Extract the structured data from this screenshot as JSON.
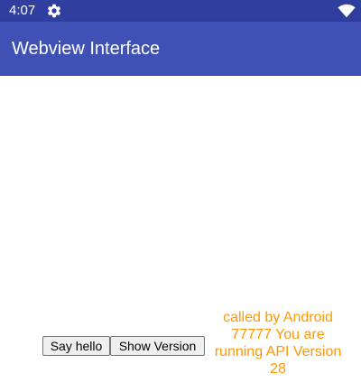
{
  "status_bar": {
    "time": "4:07",
    "icons": [
      "gear-icon",
      "wifi-icon"
    ],
    "color": "#303f9f"
  },
  "app_bar": {
    "title": "Webview Interface",
    "color": "#3f51b5"
  },
  "webview": {
    "buttons": {
      "say_hello": "Say hello",
      "show_version": "Show Version"
    },
    "message": "called by Android 77777 You are running API Version 28",
    "message_color": "#ff9800"
  }
}
